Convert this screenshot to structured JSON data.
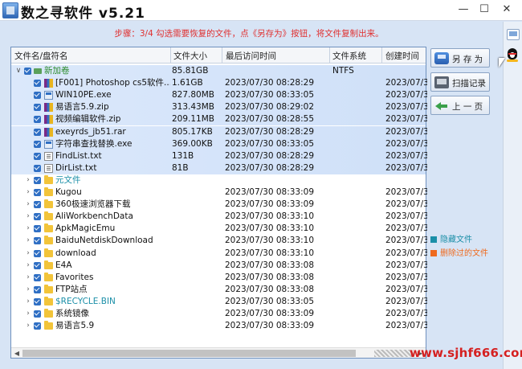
{
  "app": {
    "title": "数之寻软件 v5.21",
    "icon": "app-logo-icon"
  },
  "window_controls": {
    "minimize": "—",
    "maximize": "☐",
    "close": "✕"
  },
  "step_text": "步骤：3/4 勾选需要恢复的文件，点《另存为》按钮，将文件复制出来。",
  "table": {
    "headers": {
      "name": "文件名/盘符名",
      "size": "文件大小",
      "accessed": "最后访问时间",
      "fs": "文件系统",
      "created": "创建时间"
    },
    "rows": [
      {
        "name": "新加卷",
        "size": "85.81GB",
        "accessed": "",
        "fs": "NTFS",
        "created": "",
        "icon": "drive-icon",
        "caret": "∨",
        "style": "green"
      },
      {
        "name": "[F001] Photoshop cs5软件...",
        "size": "1.61GB",
        "accessed": "2023/07/30 08:28:29",
        "fs": "",
        "created": "2023/07/3",
        "icon": "archive-icon",
        "caret": "",
        "style": ""
      },
      {
        "name": "WIN10PE.exe",
        "size": "827.80MB",
        "accessed": "2023/07/30 08:33:05",
        "fs": "",
        "created": "2023/07/3",
        "icon": "exe-icon",
        "caret": "",
        "style": ""
      },
      {
        "name": "易语言5.9.zip",
        "size": "313.43MB",
        "accessed": "2023/07/30 08:29:02",
        "fs": "",
        "created": "2023/07/3",
        "icon": "archive-icon",
        "caret": "",
        "style": ""
      },
      {
        "name": "视频编辑软件.zip",
        "size": "209.11MB",
        "accessed": "2023/07/30 08:28:55",
        "fs": "",
        "created": "2023/07/3",
        "icon": "archive-icon",
        "caret": "",
        "style": ""
      },
      {
        "name": "exeyrds_jb51.rar",
        "size": "805.17KB",
        "accessed": "2023/07/30 08:28:29",
        "fs": "",
        "created": "2023/07/3",
        "icon": "archive-icon",
        "caret": "",
        "style": ""
      },
      {
        "name": "字符串查找替换.exe",
        "size": "369.00KB",
        "accessed": "2023/07/30 08:33:05",
        "fs": "",
        "created": "2023/07/3",
        "icon": "exe-icon",
        "caret": "",
        "style": ""
      },
      {
        "name": "FindList.txt",
        "size": "131B",
        "accessed": "2023/07/30 08:28:29",
        "fs": "",
        "created": "2023/07/3",
        "icon": "text-file-icon",
        "caret": "",
        "style": ""
      },
      {
        "name": "DirList.txt",
        "size": "81B",
        "accessed": "2023/07/30 08:28:29",
        "fs": "",
        "created": "2023/07/3",
        "icon": "text-file-icon",
        "caret": "",
        "style": ""
      },
      {
        "name": "元文件",
        "size": "",
        "accessed": "",
        "fs": "",
        "created": "",
        "icon": "folder-icon",
        "caret": "›",
        "style": "cyan"
      },
      {
        "name": "Kugou",
        "size": "",
        "accessed": "2023/07/30 08:33:09",
        "fs": "",
        "created": "2023/07/3",
        "icon": "folder-icon",
        "caret": "›",
        "style": ""
      },
      {
        "name": "360极速浏览器下载",
        "size": "",
        "accessed": "2023/07/30 08:33:09",
        "fs": "",
        "created": "2023/07/3",
        "icon": "folder-icon",
        "caret": "›",
        "style": ""
      },
      {
        "name": "AliWorkbenchData",
        "size": "",
        "accessed": "2023/07/30 08:33:10",
        "fs": "",
        "created": "2023/07/3",
        "icon": "folder-icon",
        "caret": "›",
        "style": ""
      },
      {
        "name": "ApkMagicEmu",
        "size": "",
        "accessed": "2023/07/30 08:33:10",
        "fs": "",
        "created": "2023/07/3",
        "icon": "folder-icon",
        "caret": "›",
        "style": ""
      },
      {
        "name": "BaiduNetdiskDownload",
        "size": "",
        "accessed": "2023/07/30 08:33:10",
        "fs": "",
        "created": "2023/07/3",
        "icon": "folder-icon",
        "caret": "›",
        "style": ""
      },
      {
        "name": "download",
        "size": "",
        "accessed": "2023/07/30 08:33:10",
        "fs": "",
        "created": "2023/07/3",
        "icon": "folder-icon",
        "caret": "›",
        "style": ""
      },
      {
        "name": "E4A",
        "size": "",
        "accessed": "2023/07/30 08:33:08",
        "fs": "",
        "created": "2023/07/3",
        "icon": "folder-icon",
        "caret": "›",
        "style": ""
      },
      {
        "name": "Favorites",
        "size": "",
        "accessed": "2023/07/30 08:33:08",
        "fs": "",
        "created": "2023/07/3",
        "icon": "folder-icon",
        "caret": "›",
        "style": ""
      },
      {
        "name": "FTP站点",
        "size": "",
        "accessed": "2023/07/30 08:33:08",
        "fs": "",
        "created": "2023/07/3",
        "icon": "folder-icon",
        "caret": "›",
        "style": ""
      },
      {
        "name": "$RECYCLE.BIN",
        "size": "",
        "accessed": "2023/07/30 08:33:05",
        "fs": "",
        "created": "2023/07/3",
        "icon": "folder-icon",
        "caret": "›",
        "style": "cyan"
      },
      {
        "name": "系统镜像",
        "size": "",
        "accessed": "2023/07/30 08:33:09",
        "fs": "",
        "created": "2023/07/3",
        "icon": "folder-icon",
        "caret": "›",
        "style": ""
      },
      {
        "name": "易语言5.9",
        "size": "",
        "accessed": "2023/07/30 08:33:09",
        "fs": "",
        "created": "2023/07/3",
        "icon": "folder-icon",
        "caret": "›",
        "style": ""
      }
    ]
  },
  "buttons": {
    "save_as": "另 存 为",
    "scan_record": "扫描记录",
    "prev_page": "上 一 页"
  },
  "legend": {
    "hidden": {
      "label": "隐藏文件",
      "color": "#1b8fa8"
    },
    "deleted": {
      "label": "删除过的文件",
      "color": "#ef6a1e"
    }
  },
  "scrollbar": {
    "left_arrow": "◀",
    "right_arrow": "▶"
  },
  "watermark": "www.sjhf666.com",
  "colors": {
    "accent": "#2f6fc4",
    "step_text": "#e03030",
    "green": "#2a8a2a"
  }
}
